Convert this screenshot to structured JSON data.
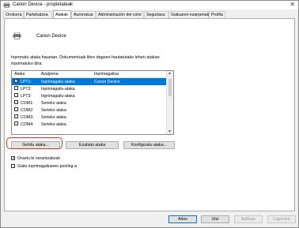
{
  "window": {
    "title": "Canon Device - propietateak",
    "close_glyph": "✕"
  },
  "tabs": [
    {
      "label": "Orokorra"
    },
    {
      "label": "Partekatzea"
    },
    {
      "label": "Atakak"
    },
    {
      "label": "Aurreratua"
    },
    {
      "label": "Administración del color"
    },
    {
      "label": "Segurtasu"
    },
    {
      "label": "Gailuaren ezarpenak"
    },
    {
      "label": "Profila"
    }
  ],
  "printer": {
    "name": "Canon Device"
  },
  "description": "Inprimatu ataka hauetan. Dokumentuak libre dagoen hautatutako lehen atakan inprimatuko dira.",
  "ports_table": {
    "columns": [
      "Ataka",
      "Azalpena",
      "Inprimagailua"
    ],
    "rows": [
      {
        "checked": true,
        "port": "LPT1:",
        "desc": "Inprimagailu-ataka",
        "printer": "Canon Device",
        "selected": true
      },
      {
        "checked": false,
        "port": "LPT2:",
        "desc": "Inprimagailu-ataka",
        "printer": ""
      },
      {
        "checked": false,
        "port": "LPT3:",
        "desc": "Inprimagailu-ataka",
        "printer": ""
      },
      {
        "checked": false,
        "port": "COM1:",
        "desc": "Serieko ataka",
        "printer": ""
      },
      {
        "checked": false,
        "port": "COM2:",
        "desc": "Serieko ataka",
        "printer": ""
      },
      {
        "checked": false,
        "port": "COM3:",
        "desc": "Serieko ataka",
        "printer": ""
      },
      {
        "checked": false,
        "port": "COM4:",
        "desc": "Serieko ataka",
        "printer": ""
      }
    ]
  },
  "port_buttons": {
    "add": "Gehitu ataka...",
    "delete": "Ezabatu ataka",
    "configure": "Konfiguratu ataka..."
  },
  "options": [
    {
      "label": "Onartu bi norantzakoak",
      "checked": true
    },
    {
      "label": "Gaitu inprimagailuaren pooling-a",
      "checked": false
    }
  ],
  "dialog_buttons": {
    "ok": "Ados",
    "cancel": "Utzi",
    "apply": "Aplikatu",
    "help": "Laguntza"
  },
  "colors": {
    "selection": "#0078d7",
    "highlight": "#e0302a"
  }
}
